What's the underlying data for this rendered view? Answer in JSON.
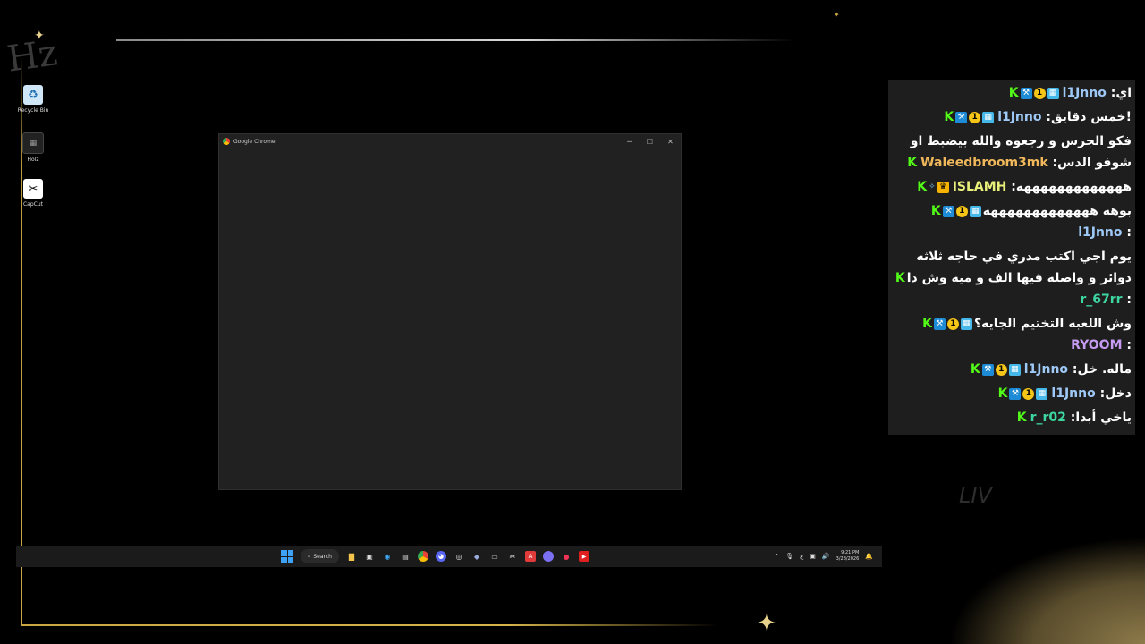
{
  "desktop": {
    "icons": [
      {
        "label": "Recycle Bin",
        "icon": "recycle-bin-icon"
      },
      {
        "label": "Holz",
        "icon": "holz-icon"
      },
      {
        "label": "CapCut",
        "icon": "capcut-icon"
      }
    ]
  },
  "brand": {
    "scribble": "Hz"
  },
  "chrome": {
    "title": "Google Chrome"
  },
  "taskbar": {
    "search_label": "Search",
    "apps": [
      "file-explorer-icon",
      "store-icon",
      "edge-icon",
      "task-manager-icon",
      "chrome-icon",
      "discord-icon",
      "obs-icon",
      "steam-icon",
      "keyboard-icon",
      "capcut-icon",
      "adobe-icon",
      "discord-alt-icon",
      "recorder-icon",
      "youtube-icon"
    ],
    "tray": {
      "language": "ع",
      "time": "9:21 PM",
      "date": "3/28/2026"
    }
  },
  "chat": {
    "colors": {
      "kick_green": "#53fc18",
      "panel_bg": "#1e1e1e"
    },
    "messages": [
      {
        "user": "l1Jnno",
        "color": "#9ec8f5",
        "badges": [
          "kick",
          "pin",
          "one",
          "grid"
        ],
        "text": "اي"
      },
      {
        "user": "l1Jnno",
        "color": "#9ec8f5",
        "badges": [
          "kick",
          "pin",
          "one",
          "grid"
        ],
        "text": "!خمس دقايق"
      },
      {
        "user": "Waleedbroom3mk",
        "color": "#f0b85b",
        "badges": [
          "kick"
        ],
        "text": "فكو الجرس و رجعوه والله بيضبط او شوفو الدس"
      },
      {
        "user": "ISLAMH",
        "color": "#e8f07a",
        "badges": [
          "kick",
          "gem",
          "crown"
        ],
        "text": "هههههههههههههه"
      },
      {
        "user": "l1Jnno",
        "color": "#9ec8f5",
        "badges": [
          "kick",
          "pin",
          "one",
          "grid"
        ],
        "text": "بوهه هههههههههههههه"
      },
      {
        "user": "r_67rr",
        "color": "#3ed6a0",
        "badges": [
          "kick"
        ],
        "text": "يوم اجي اكتب مدري في حاجه ثلاثه دوائر و واصله فيها الف و ميه وش ذا"
      },
      {
        "user": "RYOOM",
        "color": "#c79bf2",
        "badges": [
          "kick",
          "pin",
          "one",
          "grid"
        ],
        "text": "وش اللعبه التختيم الجايه؟"
      },
      {
        "user": "l1Jnno",
        "color": "#9ec8f5",
        "badges": [
          "kick",
          "pin",
          "one",
          "grid"
        ],
        "text": "ماله. خل"
      },
      {
        "user": "l1Jnno",
        "color": "#9ec8f5",
        "badges": [
          "kick",
          "pin",
          "one",
          "grid"
        ],
        "text": "دخل"
      },
      {
        "user": "r_r02",
        "color": "#3ed6a0",
        "badges": [
          "kick"
        ],
        "text": "ياخي أبدا"
      }
    ],
    "watermark": "LIV"
  }
}
